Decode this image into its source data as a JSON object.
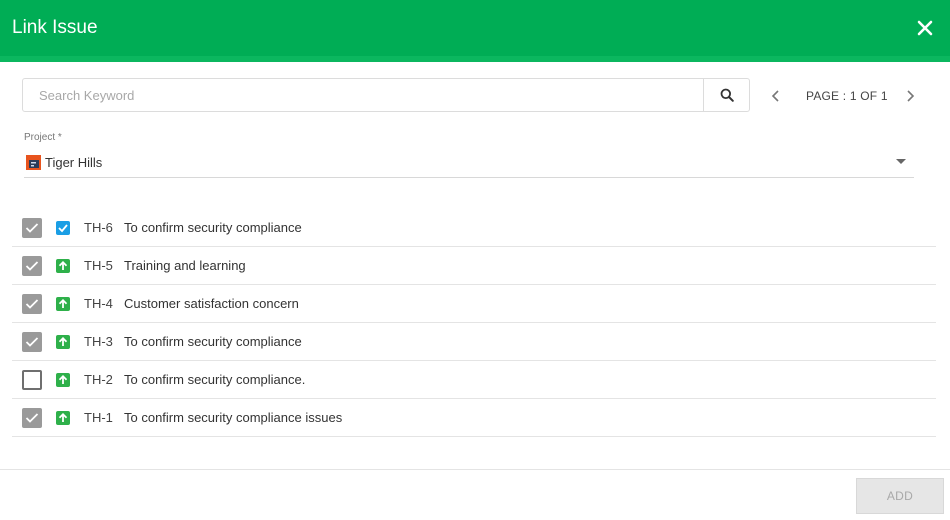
{
  "dialog": {
    "title": "Link Issue"
  },
  "search": {
    "placeholder": "Search Keyword",
    "value": ""
  },
  "pager": {
    "label": "PAGE : 1 OF 1"
  },
  "project": {
    "label": "Project *",
    "selected": "Tiger Hills"
  },
  "issues": [
    {
      "key": "TH-6",
      "summary": "To confirm security compliance",
      "selected": true,
      "type_icon": "checkbox-task-icon"
    },
    {
      "key": "TH-5",
      "summary": "Training and learning",
      "selected": true,
      "type_icon": "arrow-up-icon"
    },
    {
      "key": "TH-4",
      "summary": "Customer satisfaction concern",
      "selected": true,
      "type_icon": "arrow-up-icon"
    },
    {
      "key": "TH-3",
      "summary": "To confirm security compliance",
      "selected": true,
      "type_icon": "arrow-up-icon"
    },
    {
      "key": "TH-2",
      "summary": "To confirm security compliance.",
      "selected": false,
      "type_icon": "arrow-up-icon"
    },
    {
      "key": "TH-1",
      "summary": "To confirm security compliance issues",
      "selected": true,
      "type_icon": "arrow-up-icon"
    }
  ],
  "footer": {
    "add_label": "ADD"
  },
  "colors": {
    "header": "#00ad55",
    "task_icon": "#1a9ee5",
    "story_icon": "#2eb04a"
  }
}
